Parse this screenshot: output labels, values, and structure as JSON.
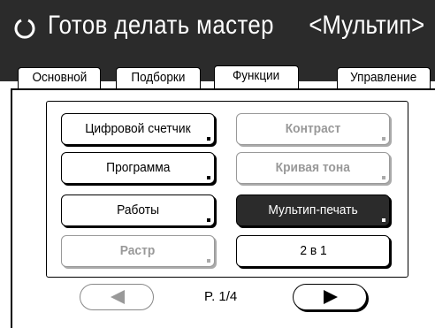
{
  "header": {
    "status_icon": "circle-status-icon",
    "status_text": "Готов делать мастер",
    "mode_text": "<Мультип>"
  },
  "tabs": [
    {
      "label": "Основной",
      "active": false
    },
    {
      "label": "Подборки",
      "active": false
    },
    {
      "label": "Функции",
      "active": true
    },
    {
      "label": "Управление",
      "active": false
    }
  ],
  "functions": {
    "buttons": [
      {
        "label": "Цифровой счетчик",
        "state": "normal"
      },
      {
        "label": "Контраст",
        "state": "disabled"
      },
      {
        "label": "Программа",
        "state": "normal"
      },
      {
        "label": "Кривая тона",
        "state": "disabled"
      },
      {
        "label": "Работы",
        "state": "normal"
      },
      {
        "label": "Мультип-печать",
        "state": "selected"
      },
      {
        "label": "Растр",
        "state": "disabled"
      },
      {
        "label": "2 в 1",
        "state": "normal"
      }
    ]
  },
  "pagination": {
    "prev_icon": "triangle-left-icon",
    "next_icon": "triangle-right-icon",
    "page_text": "P. 1/4"
  },
  "colors": {
    "header_bg": "#2b2b2b",
    "selected_bg": "#2b2b2b",
    "disabled_text": "#999999"
  }
}
